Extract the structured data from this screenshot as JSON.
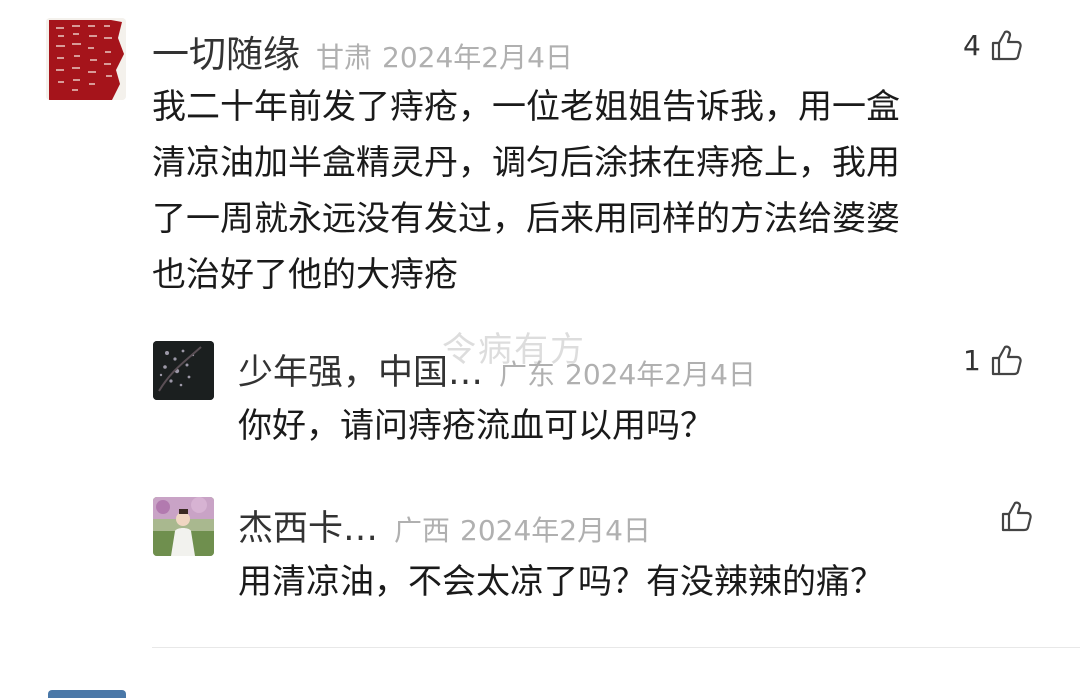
{
  "comments": [
    {
      "user": "一切随缘",
      "location": "甘肃",
      "date": "2024年2月4日",
      "likes": "4",
      "text_lines": [
        "我二十年前发了痔疮，一位老姐姐告诉我，用一盒",
        "清凉油加半盒精灵丹，调匀后涂抹在痔疮上，我用",
        "了一周就永远没有发过，后来用同样的方法给婆婆",
        "也治好了他的大痔疮"
      ]
    }
  ],
  "replies": [
    {
      "user": "少年强，中国…",
      "location": "广东",
      "date": "2024年2月4日",
      "likes": "1",
      "text": "你好，请问痔疮流血可以用吗？"
    },
    {
      "user": "杰西卡…",
      "location": "广西",
      "date": "2024年2月4日",
      "likes": "",
      "text": "用清凉油，不会太凉了吗？有没辣辣的痛？"
    }
  ],
  "watermark": "令病有方",
  "icons": {
    "like": "thumbs-up-icon"
  }
}
